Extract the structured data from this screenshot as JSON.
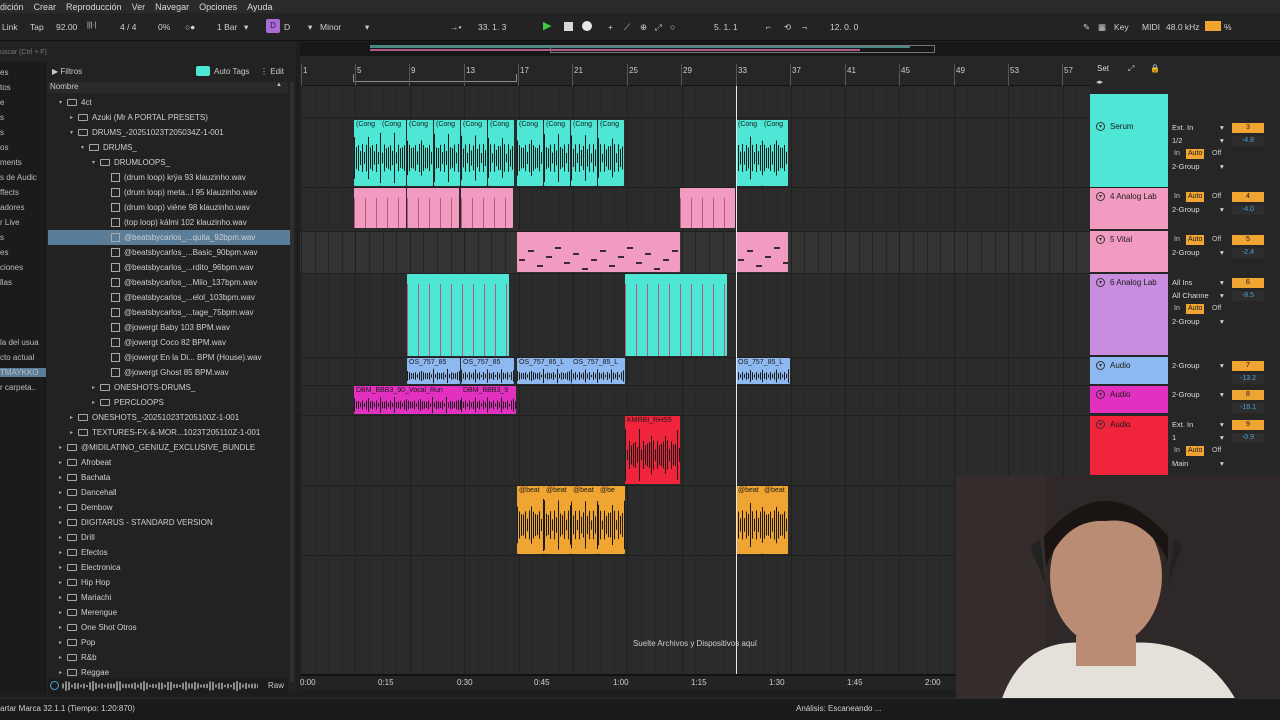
{
  "menu": [
    "dición",
    "Crear",
    "Reproducción",
    "Ver",
    "Navegar",
    "Opciones",
    "Ayuda"
  ],
  "transport": {
    "link": "Link",
    "tap": "Tap",
    "tempo": "92.00",
    "sig": "4 / 4",
    "cpu": "0%",
    "quant": "1 Bar",
    "key_letter": "D",
    "key_note": "D",
    "scale": "Minor",
    "pos": "33.  1.  3",
    "loop_start": "5.  1.  1",
    "loop_len": "12.  0.  0",
    "key_label": "Key",
    "midi_label": "MIDI",
    "sample_rate": "48.0 kHz",
    "cpu_pct": "%"
  },
  "browser": {
    "search_placeholder": "uscar (Ctrl + F)",
    "filters": "Filtros",
    "auto_tags": "Auto Tags",
    "edit": "Edit",
    "name_header": "Nombre",
    "places": [
      "es",
      "tos",
      "e",
      "s",
      "s",
      "os",
      "ments",
      "s de Audic",
      "ffects",
      "adores",
      "r Live",
      "s",
      "es",
      "ciones",
      "llas",
      "",
      "",
      "",
      "la del usua",
      "cto actual",
      "TMAYKKO",
      "r carpeta.."
    ],
    "items": [
      {
        "label": "4ct",
        "indent": 1,
        "type": "folder",
        "arrow": "▾"
      },
      {
        "label": "Azuki (Mr A PORTAL PRESETS)",
        "indent": 2,
        "type": "folder",
        "arrow": "▸"
      },
      {
        "label": "DRUMS_-20251023T205034Z-1-001",
        "indent": 2,
        "type": "folder",
        "arrow": "▾"
      },
      {
        "label": "DRUMS_",
        "indent": 3,
        "type": "folder",
        "arrow": "▾"
      },
      {
        "label": "DRUMLOOPS_",
        "indent": 4,
        "type": "folder",
        "arrow": "▾"
      },
      {
        "label": "(drum loop) krÿa 93 klauzinho.wav",
        "indent": 5,
        "type": "wav",
        "arrow": ""
      },
      {
        "label": "(drum loop) meta...l 95 klauzinho.wav",
        "indent": 5,
        "type": "wav",
        "arrow": ""
      },
      {
        "label": "(drum loop) viéne 98 klauzinho.wav",
        "indent": 5,
        "type": "wav",
        "arrow": ""
      },
      {
        "label": "(top loop) kálmi 102 klauzinho.wav",
        "indent": 5,
        "type": "wav",
        "arrow": ""
      },
      {
        "label": "@beatsbycarlos_...quita_92bpm.wav",
        "indent": 5,
        "type": "wav",
        "arrow": "",
        "selected": true
      },
      {
        "label": "@beatsbycarlos_...Basic_90bpm.wav",
        "indent": 5,
        "type": "wav",
        "arrow": ""
      },
      {
        "label": "@beatsbycarlos_...rdito_96bpm.wav",
        "indent": 5,
        "type": "wav",
        "arrow": ""
      },
      {
        "label": "@beatsbycarlos_...Milo_137bpm.wav",
        "indent": 5,
        "type": "wav",
        "arrow": ""
      },
      {
        "label": "@beatsbycarlos_...elol_103bpm.wav",
        "indent": 5,
        "type": "wav",
        "arrow": ""
      },
      {
        "label": "@beatsbycarlos_...tage_75bpm.wav",
        "indent": 5,
        "type": "wav",
        "arrow": ""
      },
      {
        "label": "@jowergt Baby 103 BPM.wav",
        "indent": 5,
        "type": "wav",
        "arrow": ""
      },
      {
        "label": "@jowergt Coco 82 BPM.wav",
        "indent": 5,
        "type": "wav",
        "arrow": ""
      },
      {
        "label": "@jowergt En la Di... BPM (House).wav",
        "indent": 5,
        "type": "wav",
        "arrow": ""
      },
      {
        "label": "@jowergt Ghost 85 BPM.wav",
        "indent": 5,
        "type": "wav",
        "arrow": ""
      },
      {
        "label": "ONESHOTS-DRUMS_",
        "indent": 4,
        "type": "folder",
        "arrow": "▸"
      },
      {
        "label": "PERCLOOPS",
        "indent": 4,
        "type": "folder",
        "arrow": "▸"
      },
      {
        "label": "ONESHOTS_-20251023T205100Z-1-001",
        "indent": 2,
        "type": "folder",
        "arrow": "▸"
      },
      {
        "label": "TEXTURES-FX-&-MOR...1023T205110Z-1-001",
        "indent": 2,
        "type": "folder",
        "arrow": "▸"
      },
      {
        "label": "@MIDILATINO_GENIUZ_EXCLUSIVE_BUNDLE",
        "indent": 1,
        "type": "folder",
        "arrow": "▸"
      },
      {
        "label": "Afrobeat",
        "indent": 1,
        "type": "folder",
        "arrow": "▸"
      },
      {
        "label": "Bachata",
        "indent": 1,
        "type": "folder",
        "arrow": "▸"
      },
      {
        "label": "Dancehall",
        "indent": 1,
        "type": "folder",
        "arrow": "▸"
      },
      {
        "label": "Dembow",
        "indent": 1,
        "type": "folder",
        "arrow": "▸"
      },
      {
        "label": "DIGITARUS - STANDARD VERSION",
        "indent": 1,
        "type": "folder",
        "arrow": "▸"
      },
      {
        "label": "Drill",
        "indent": 1,
        "type": "folder",
        "arrow": "▸"
      },
      {
        "label": "Efectos",
        "indent": 1,
        "type": "folder",
        "arrow": "▸"
      },
      {
        "label": "Electronica",
        "indent": 1,
        "type": "folder",
        "arrow": "▸"
      },
      {
        "label": "Hip Hop",
        "indent": 1,
        "type": "folder",
        "arrow": "▸"
      },
      {
        "label": "Mariachi",
        "indent": 1,
        "type": "folder",
        "arrow": "▸"
      },
      {
        "label": "Merengue",
        "indent": 1,
        "type": "folder",
        "arrow": "▸"
      },
      {
        "label": "One Shot Otros",
        "indent": 1,
        "type": "folder",
        "arrow": "▸"
      },
      {
        "label": "Pop",
        "indent": 1,
        "type": "folder",
        "arrow": "▸"
      },
      {
        "label": "R&b",
        "indent": 1,
        "type": "folder",
        "arrow": "▸"
      },
      {
        "label": "Reggae",
        "indent": 1,
        "type": "folder",
        "arrow": "▸"
      }
    ],
    "raw": "Raw"
  },
  "ruler": {
    "bars": [
      "1",
      "5",
      "9",
      "13",
      "17",
      "21",
      "25",
      "29",
      "33",
      "37",
      "41",
      "45",
      "49",
      "53",
      "57"
    ],
    "times": [
      "0:00",
      "0:15",
      "0:30",
      "0:45",
      "1:00",
      "1:15",
      "1:30",
      "1:45",
      "2:00"
    ],
    "set": "Set"
  },
  "drop_hint": "Suelte Archivos y Dispositivos aquí",
  "clips": {
    "conga": [
      "(Cong",
      "(Cong",
      "(Cong",
      "(Cong",
      "(Cong",
      "(Cong",
      "(Cong",
      "(Cong",
      "(Cong",
      "(Cong",
      "(Cong",
      "(Cong"
    ],
    "os": [
      "OS_757_85",
      "OS_757_85",
      "OS_757_85_L",
      "OS_757_85_L",
      "OS_757_85_L"
    ],
    "vocal": [
      "DBM_BBB3_90_Vocal_Run",
      "DBM_BBB3_9"
    ],
    "kmrbi": "KMRBI_RHS5",
    "beat": [
      "@beat",
      "@beat",
      "@beat",
      "@be",
      "@beat",
      "@beat"
    ]
  },
  "tracks": [
    {
      "name": "Serum",
      "color": "#4ee6d4",
      "in": "Ext. In",
      "in2": "1/2",
      "out": "2-Group",
      "num": "3",
      "vol": "-4.8"
    },
    {
      "name": "4 Analog Lab",
      "color": "#f29bc0",
      "in": "In",
      "out": "2-Group",
      "num": "4",
      "vol": "-4.0"
    },
    {
      "name": "5 Vital",
      "color": "#f29bc0",
      "in": "In",
      "out": "2-Group",
      "num": "5",
      "vol": "-2.4"
    },
    {
      "name": "6 Analog Lab",
      "color": "#c98de0",
      "in": "All Ins",
      "in2": "All Channe",
      "out": "2-Group",
      "num": "6",
      "vol": "-8.5"
    },
    {
      "name": "Audio",
      "color": "#8db8f0",
      "in": "2-Group",
      "num": "7",
      "vol": "-13.2"
    },
    {
      "name": "Audio",
      "color": "#e231c0",
      "in": "2-Group",
      "num": "8",
      "vol": "-18.1"
    },
    {
      "name": "Audio",
      "color": "#f0243a",
      "in": "Ext. In",
      "in2": "1",
      "out": "Main",
      "num": "9",
      "vol": "-0.9"
    }
  ],
  "mixer_btns": {
    "in": "In",
    "auto": "Auto",
    "off": "Off"
  },
  "status": {
    "left": "artar Marca 32.1.1 (Tiempo: 1:20:870)",
    "right": "Análisis: Escaneando ..."
  }
}
